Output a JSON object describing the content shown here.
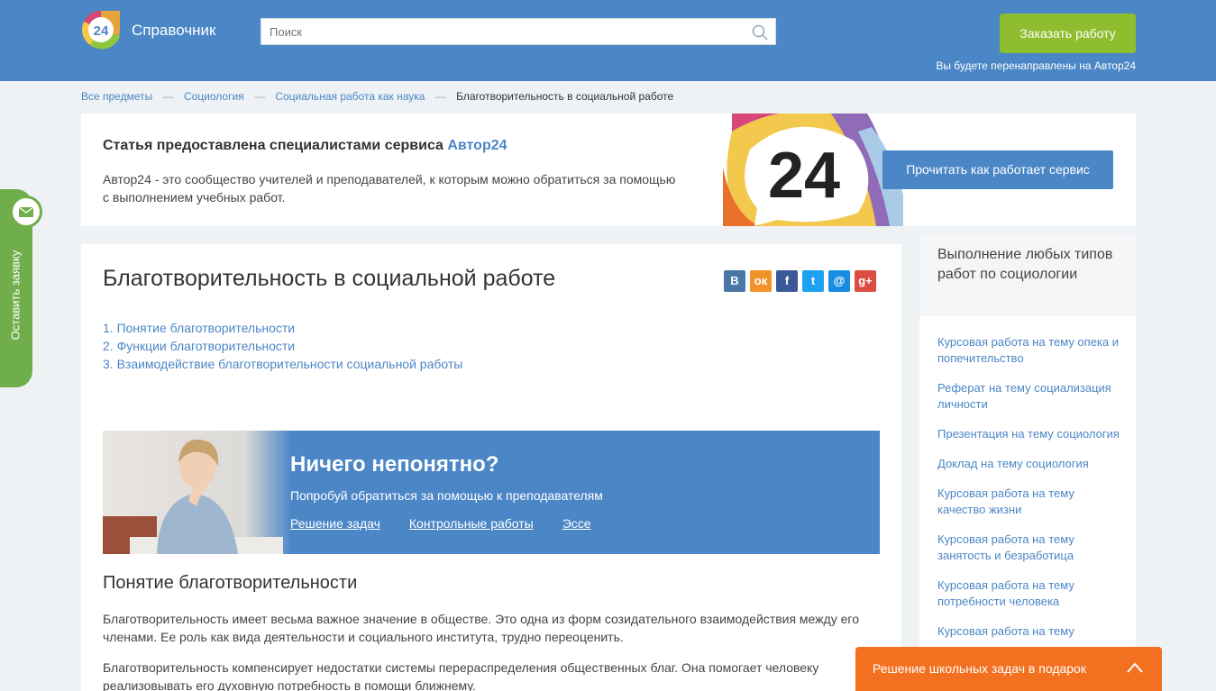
{
  "header": {
    "logo_number": "24",
    "logo_text": "Справочник",
    "search_placeholder": "Поиск",
    "order_button": "Заказать работу",
    "redirect_note": "Вы будете перенаправлены на Автор24"
  },
  "breadcrumb": {
    "items": [
      "Все предметы",
      "Социология",
      "Социальная работа как наука"
    ],
    "separator": "—",
    "current": "Благотворительность в социальной работе"
  },
  "promo": {
    "title_prefix": "Статья предоставлена специалистами сервиса ",
    "title_brand": "Автор24",
    "text": "Автор24 - это сообщество учителей и преподавателей, к которым можно обратиться за помощью с выполнением учебных работ.",
    "art_number": "24",
    "button": "Прочитать как работает сервис"
  },
  "article": {
    "title": "Благотворительность в социальной работе",
    "share": [
      {
        "label": "В",
        "color": "#4a76a8"
      },
      {
        "label": "ок",
        "color": "#f2922b"
      },
      {
        "label": "f",
        "color": "#3b5998"
      },
      {
        "label": "t",
        "color": "#1da1f2"
      },
      {
        "label": "@",
        "color": "#168de2"
      },
      {
        "label": "g+",
        "color": "#dc4e41"
      }
    ],
    "toc": [
      "1. Понятие благотворительности",
      "2. Функции благотворительности",
      "3. Взаимодействие благотворительности социальной работы"
    ],
    "help": {
      "title": "Ничего непонятно?",
      "subtitle": "Попробуй обратиться за помощью к преподавателям",
      "links": [
        "Решение задач",
        "Контрольные работы",
        "Эссе"
      ]
    },
    "section_title": "Понятие благотворительности",
    "paragraphs": [
      "Благотворительность имеет весьма важное значение в обществе. Это одна из форм созидательного взаимодействия между его членами. Ее роль как вида деятельности и социального института, трудно переоценить.",
      "Благотворительность компенсирует недостатки системы перераспределения общественных благ. Она помогает человеку реализовывать его духовную потребность в помощи ближнему."
    ]
  },
  "sidebar": {
    "heading": "Выполнение любых типов работ по социологии",
    "links": [
      "Курсовая работа на тему опека и попечительство",
      "Реферат на тему социализация личности",
      "Презентация на тему социология",
      "Доклад на тему социология",
      "Курсовая работа на тему качество жизни",
      "Курсовая работа на тему занятость и безработица",
      "Курсовая работа на тему потребности человека",
      "Курсовая работа на тему"
    ]
  },
  "side_tab": {
    "label": "Оставить заявку"
  },
  "gift_bar": {
    "text": "Решение школьных задач в подарок"
  },
  "colors": {
    "header_blue": "#4b86c6",
    "order_green": "#8ebd2f",
    "tab_green": "#6fae4b",
    "gift_orange": "#f37021"
  }
}
